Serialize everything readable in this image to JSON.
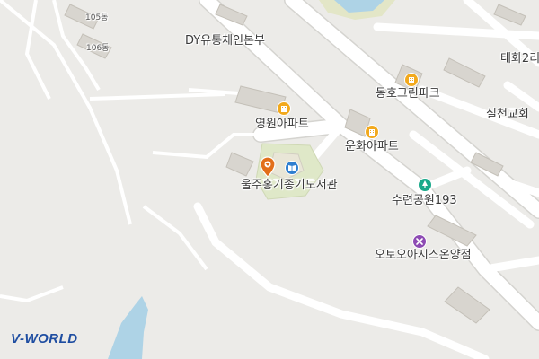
{
  "map": {
    "colors": {
      "background": "#ecebe8",
      "road": "#ffffff",
      "road_outline": "#d5d4d0",
      "building": "#d8d5cf",
      "building_outline": "#c4c0b8",
      "park": "#dfe8c8",
      "water": "#aed3e6",
      "poi_apartment": "#f2a91d",
      "poi_library": "#2f7fd0",
      "poi_park": "#19a98a",
      "poi_car": "#8d4bb3",
      "marker": "#e26f1a"
    },
    "labels": {
      "building_105": "105동",
      "building_106": "106동",
      "dy_store": "DY유통체인본부",
      "taehwa": "태화2리",
      "donghogreen": "동호그린파크",
      "youngwon": "영원아파트",
      "silcheon": "실천교회",
      "unhwa": "운화아파트",
      "library": "울주홍기종기도서관",
      "suryeon_park": "수련공원193",
      "autooasis": "오토오아시스온양점"
    },
    "icons": {
      "youngwon": "apartment-icon",
      "donghogreen": "apartment-icon",
      "unhwa": "apartment-icon",
      "library": "library-icon",
      "suryeon_park": "park-icon",
      "autooasis": "car-repair-icon",
      "marker": "location-pin-icon"
    },
    "logo": {
      "mark": "V",
      "text": "-WORLD"
    }
  }
}
